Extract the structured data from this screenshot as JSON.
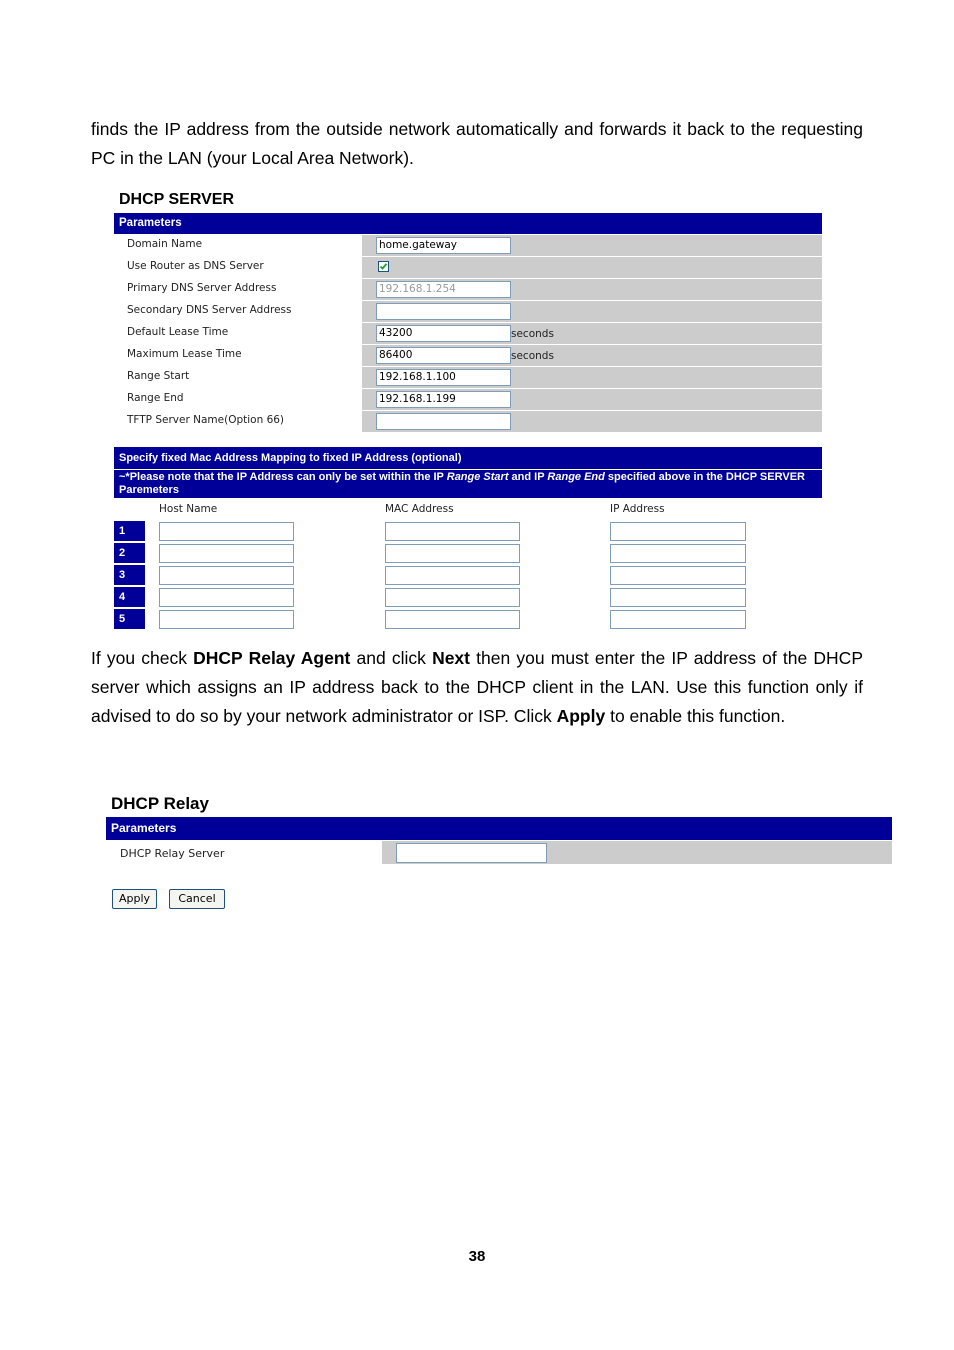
{
  "intro_text": "finds the IP address from the outside network automatically and forwards it back to the requesting PC in the LAN (your Local Area Network).",
  "dhcp_server": {
    "title": "DHCP SERVER",
    "params_header": "Parameters",
    "fields": [
      {
        "label": "Domain Name",
        "value": "home.gateway"
      },
      {
        "label": "Use Router as DNS Server",
        "checked": true
      },
      {
        "label": "Primary DNS Server Address",
        "value": "192.168.1.254",
        "disabled": true
      },
      {
        "label": "Secondary DNS Server Address",
        "value": ""
      },
      {
        "label": "Default Lease Time",
        "value": "43200",
        "unit": "seconds"
      },
      {
        "label": "Maximum Lease Time",
        "value": "86400",
        "unit": "seconds"
      },
      {
        "label": "Range Start",
        "value": "192.168.1.100"
      },
      {
        "label": "Range End",
        "value": "192.168.1.199"
      },
      {
        "label": "TFTP Server Name(Option 66)",
        "value": ""
      }
    ],
    "mapping_header": "Specify fixed Mac Address Mapping to fixed IP Address (optional)",
    "note_prefix": "~*Please note that the IP Address can only be set within the IP ",
    "note_range_start": "Range Start",
    "note_mid": " and IP ",
    "note_range_end": "Range End",
    "note_suffix": " specified above in the DHCP SERVER Paremeters",
    "columns": [
      "Host Name",
      "MAC Address",
      "IP Address"
    ],
    "rows": [
      {
        "index": "1",
        "host": "",
        "mac": "",
        "ip": ""
      },
      {
        "index": "2",
        "host": "",
        "mac": "",
        "ip": ""
      },
      {
        "index": "3",
        "host": "",
        "mac": "",
        "ip": ""
      },
      {
        "index": "4",
        "host": "",
        "mac": "",
        "ip": ""
      },
      {
        "index": "5",
        "host": "",
        "mac": "",
        "ip": ""
      }
    ]
  },
  "relay_text": {
    "p1": "If you check ",
    "b1": "DHCP Relay Agent",
    "p2": " and click ",
    "b2": "Next",
    "p3": " then you must enter the IP address of the DHCP server which assigns an IP address back to the DHCP client in the LAN. Use this function only if advised to do so by your network administrator or ISP. Click ",
    "b3": "Apply",
    "p4": " to enable this function."
  },
  "dhcp_relay": {
    "title": "DHCP Relay",
    "params_header": "Parameters",
    "field_label": "DHCP Relay Server",
    "field_value": "",
    "apply_label": "Apply",
    "cancel_label": "Cancel"
  },
  "page_number": "38"
}
